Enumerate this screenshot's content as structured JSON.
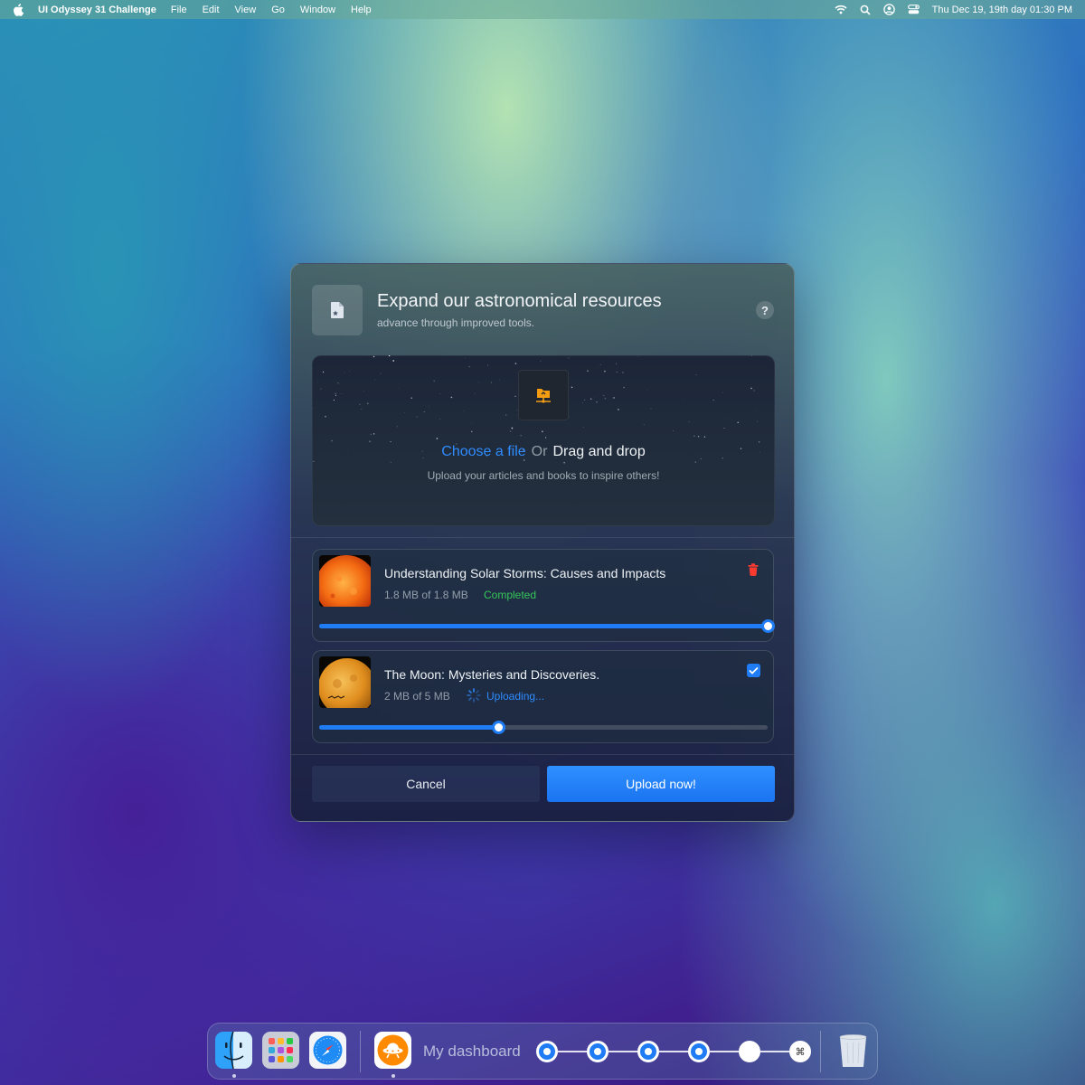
{
  "menubar": {
    "app_name": "UI Odyssey 31 Challenge",
    "menus": [
      "File",
      "Edit",
      "View",
      "Go",
      "Window",
      "Help"
    ],
    "clock": "Thu Dec 19, 19th day  01:30 PM"
  },
  "dialog": {
    "title": "Expand our astronomical resources",
    "subtitle": "advance through improved tools.",
    "help_label": "?",
    "dropzone": {
      "choose_label": "Choose a file",
      "or_label": "Or",
      "drag_label": "Drag and drop",
      "hint": "Upload your articles and books to inspire others!"
    },
    "files": [
      {
        "name": "Understanding Solar Storms: Causes and Impacts",
        "size": "1.8 MB of 1.8 MB",
        "status": "Completed",
        "progress": 1.0,
        "icon": "trash-icon"
      },
      {
        "name": "The Moon: Mysteries and Discoveries.",
        "size": "2 MB of 5 MB",
        "status": "Uploading...",
        "progress": 0.4,
        "icon": "checkbox-icon"
      }
    ],
    "cancel_label": "Cancel",
    "upload_label": "Upload now!"
  },
  "dock": {
    "apps": [
      "finder-icon",
      "launchpad-icon",
      "safari-icon"
    ],
    "dashboard_label": "My dashboard",
    "steps_total": 6,
    "steps_completed": 4,
    "last_step_glyph": "⌘"
  },
  "colors": {
    "accent": "#1f7cf5",
    "link": "#2e8cff",
    "success": "#35c759",
    "danger": "#ff3b30"
  }
}
